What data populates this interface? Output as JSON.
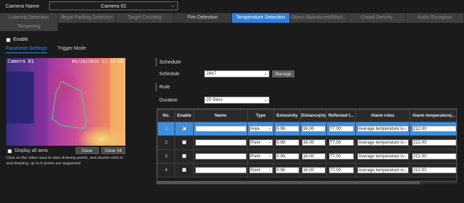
{
  "camera": {
    "label": "Camera Name",
    "value": "Camera 01"
  },
  "tabs_row1": [
    {
      "label": "Loitering Detection",
      "state": "normal"
    },
    {
      "label": "Illegal Parking Detection",
      "state": "normal"
    },
    {
      "label": "Target Counting",
      "state": "normal"
    },
    {
      "label": "Fire Detection",
      "state": "white"
    },
    {
      "label": "Temperature Detection",
      "state": "selected"
    },
    {
      "label": "Object Abandoned/Missi...",
      "state": "normal"
    },
    {
      "label": "Crowd Density",
      "state": "normal"
    },
    {
      "label": "Audio Exception",
      "state": "normal"
    }
  ],
  "tabs_row2": [
    {
      "label": "Tampering",
      "state": "normal"
    }
  ],
  "enable": {
    "label": "Enable",
    "checked": false
  },
  "subtabs": [
    {
      "label": "Parameter Settings",
      "active": true
    },
    {
      "label": "Trigger Mode",
      "active": false
    }
  ],
  "video": {
    "camera_osd": "Camera 01",
    "timestamp": "09/10/2024 12:18:59"
  },
  "video_controls": {
    "display_all": "Display all area",
    "clear": "Clear",
    "clear_all": "Clear All",
    "hint": "Click on the video area to start drawing points, and double-click to end drawing, up to 6 points are supported"
  },
  "schedule": {
    "section": "Schedule",
    "label": "Schedule",
    "value": "24x7",
    "manage": "Manage"
  },
  "rule": {
    "section": "Rule",
    "duration_label": "Duration",
    "duration_value": "20 Secs"
  },
  "table": {
    "headers": [
      "No.",
      "Enable",
      "Name",
      "Type",
      "Emissivity",
      "Distance(m)",
      "Reflected t...",
      "Alarm rules",
      "Alarm temperature(..."
    ],
    "rows": [
      {
        "no": "1",
        "enabled": true,
        "name": "",
        "type": "Area",
        "emissivity": "0.96",
        "distance": "16.00",
        "reflected": "77.00",
        "rule": "Average temperature is",
        "alarm": "212.00",
        "selected": true
      },
      {
        "no": "2",
        "enabled": false,
        "name": "",
        "type": "Point",
        "emissivity": "0.96",
        "distance": "16.00",
        "reflected": "77.00",
        "rule": "Average temperature is",
        "alarm": "212.00",
        "selected": false
      },
      {
        "no": "3",
        "enabled": false,
        "name": "",
        "type": "Point",
        "emissivity": "0.96",
        "distance": "16.00",
        "reflected": "77.00",
        "rule": "Average temperature is",
        "alarm": "212.00",
        "selected": false
      },
      {
        "no": "4",
        "enabled": false,
        "name": "",
        "type": "Point",
        "emissivity": "0.96",
        "distance": "16.00",
        "reflected": "77.00",
        "rule": "Average temperature is",
        "alarm": "212.00",
        "selected": false
      }
    ]
  },
  "colors": {
    "accent": "#2f7fd8",
    "link": "#2f8bff",
    "background": "#1b1b1b"
  }
}
